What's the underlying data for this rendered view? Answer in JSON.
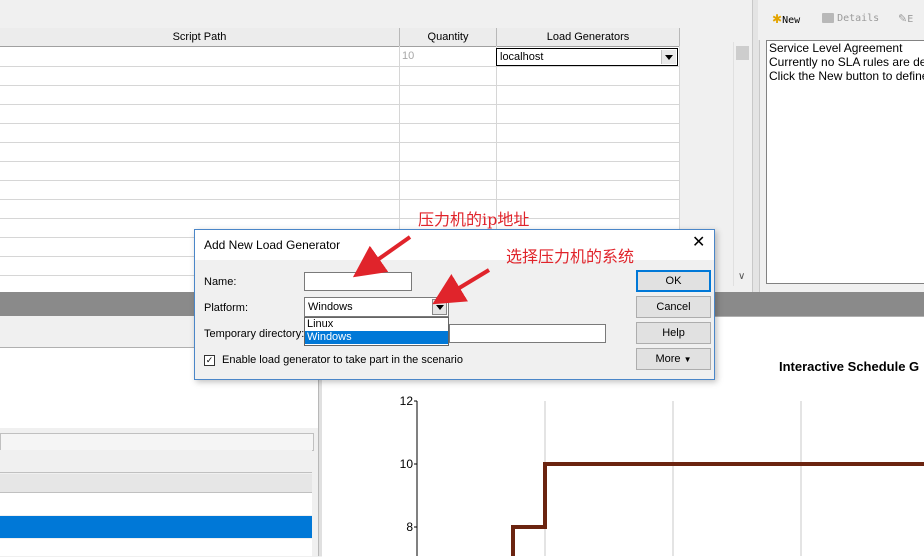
{
  "grid": {
    "columns": [
      "Script Path",
      "Quantity",
      "Load Generators"
    ],
    "row1": {
      "quantity": "10",
      "load_generator": "localhost"
    }
  },
  "sla": {
    "toolbar": {
      "new_label": "New",
      "details_label": "Details",
      "edit_label": "E"
    },
    "lines": [
      "Service Level Agreement",
      "Currently no SLA rules are defin",
      "Click the New button to define S"
    ]
  },
  "chart": {
    "title": "Interactive Schedule G"
  },
  "chart_data": {
    "type": "line",
    "title": "Interactive Schedule G",
    "y_ticks": [
      12,
      10,
      8
    ],
    "ylim": [
      7,
      12
    ],
    "series": [
      {
        "points": [
          [
            0.75,
            7
          ],
          [
            0.75,
            8
          ],
          [
            1,
            8
          ],
          [
            1,
            10
          ],
          [
            4,
            10
          ]
        ],
        "color": "#6b2410"
      }
    ],
    "grid": true
  },
  "dialog": {
    "title": "Add New Load Generator",
    "name_label": "Name:",
    "name_value": "",
    "platform_label": "Platform:",
    "platform_value": "Windows",
    "platform_options": [
      "Linux",
      "Windows"
    ],
    "temp_dir_label": "Temporary directory:",
    "checkbox_label": "Enable load generator to take part in the scenario",
    "checkbox_checked": true,
    "buttons": {
      "ok": "OK",
      "cancel": "Cancel",
      "help": "Help",
      "more": "More"
    }
  },
  "annotations": {
    "ip": "压力机的ip地址",
    "system": "选择压力机的系统"
  },
  "colors": {
    "selection": "#0078d7",
    "annotation": "#e0242b",
    "schedule_line": "#6b2410"
  }
}
